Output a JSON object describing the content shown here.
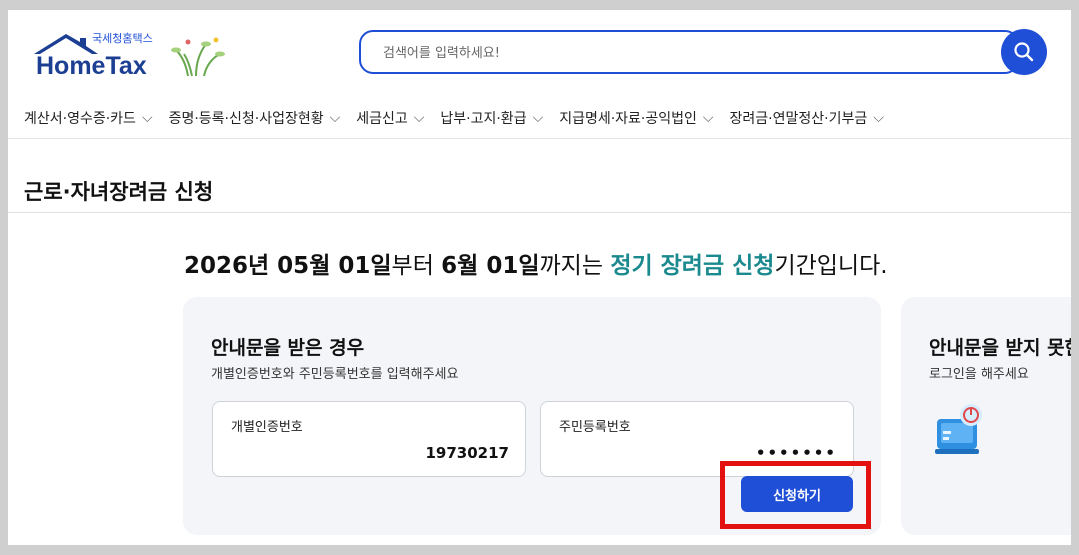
{
  "logo": {
    "small_text": "국세청홈택스",
    "brand": "HomeTax"
  },
  "search": {
    "placeholder": "검색어를 입력하세요!"
  },
  "nav": {
    "items": [
      {
        "label": "계산서·영수증·카드"
      },
      {
        "label": "증명·등록·신청·사업장현황"
      },
      {
        "label": "세금신고"
      },
      {
        "label": "납부·고지·환급"
      },
      {
        "label": "지급명세·자료·공익법인"
      },
      {
        "label": "장려금·연말정산·기부금"
      }
    ]
  },
  "page": {
    "title": "근로·자녀장려금 신청"
  },
  "announcement": {
    "start": "2026년 05월 01일",
    "mid": "부터 ",
    "end": "6월 01일",
    "mid2": "까지는 ",
    "highlight": "정기 장려금 신청",
    "tail": "기간입니다."
  },
  "card_notice": {
    "title": "안내문을 받은 경우",
    "subtitle": "개별인증번호와 주민등록번호를 입력해주세요",
    "field_id_label": "개별인증번호",
    "field_id_value": "19730217",
    "field_rrn_label": "주민등록번호",
    "field_rrn_value": "•••••••",
    "submit_label": "신청하기"
  },
  "card_login": {
    "title": "안내문을 받지 못한",
    "subtitle": "로그인을 해주세요"
  },
  "colors": {
    "accent": "#1f4fd6",
    "highlight_text": "#1a8a8e",
    "annotation": "#e41111"
  }
}
